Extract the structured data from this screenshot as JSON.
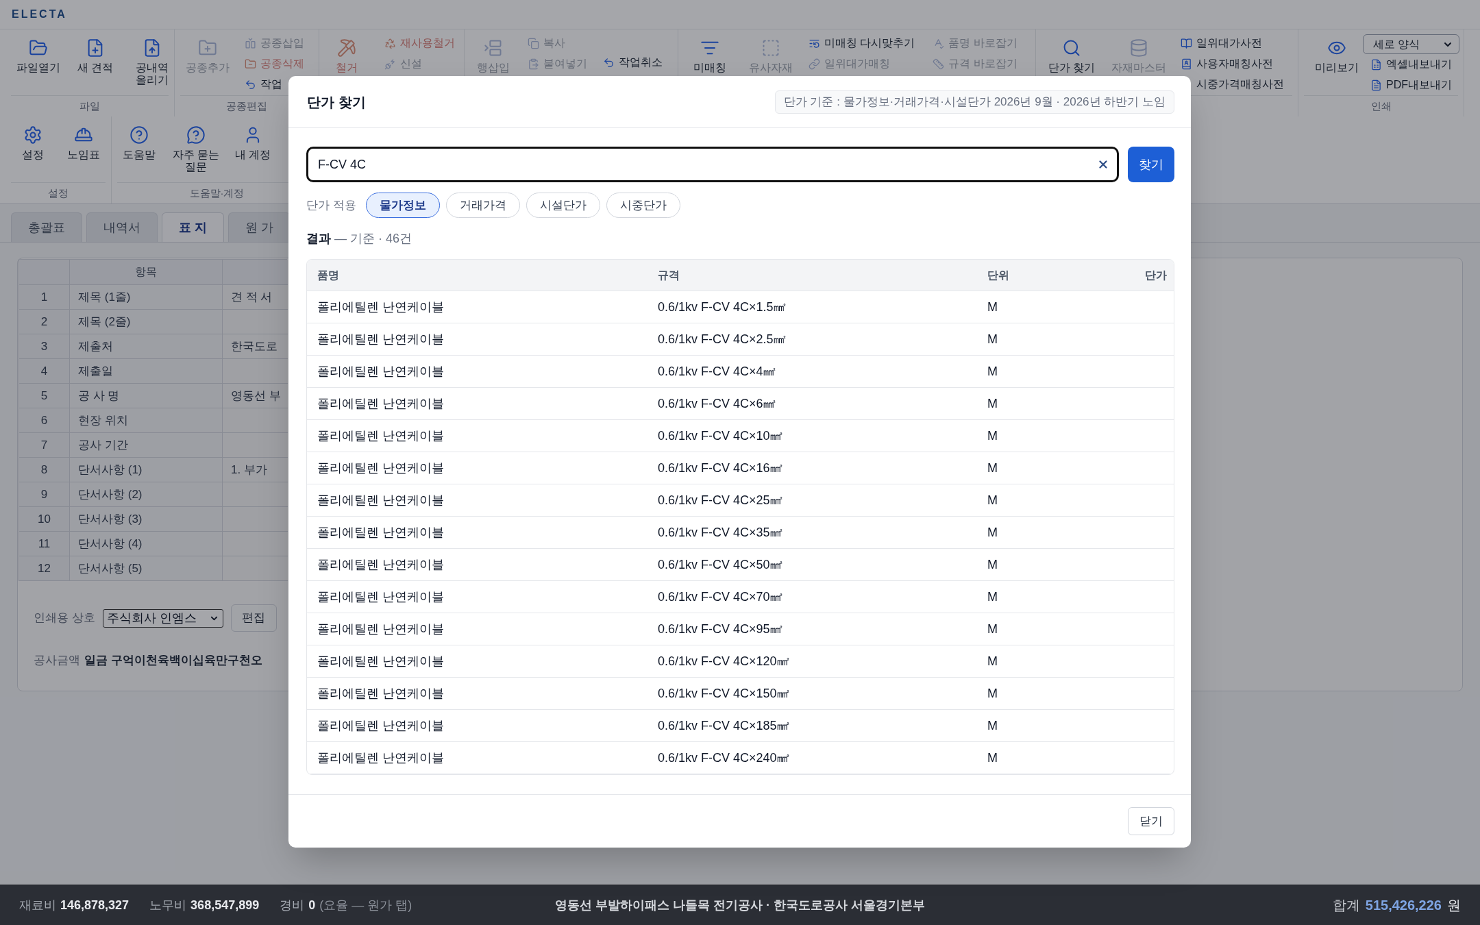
{
  "app": {
    "logo": "ELECTA"
  },
  "ribbon": {
    "rows": [
      [
        {
          "label": "파일",
          "blocks": [
            {
              "kind": "large",
              "label": "파일열기",
              "disabled": false,
              "danger": false
            },
            {
              "kind": "large",
              "label": "새 견적",
              "disabled": false,
              "danger": false
            },
            {
              "kind": "large",
              "label": "공내역 올리기",
              "disabled": false,
              "danger": false
            }
          ]
        },
        {
          "label": "공종편집",
          "blocks": [
            {
              "kind": "large",
              "label": "공종추가",
              "disabled": true,
              "danger": false
            },
            {
              "kind": "column",
              "items": [
                {
                  "kind": "button",
                  "label": "공종삽입",
                  "disabled": true,
                  "danger": false
                },
                {
                  "kind": "button",
                  "label": "공종삭제",
                  "disabled": true,
                  "danger": true
                },
                {
                  "kind": "button",
                  "label": "작업",
                  "disabled": false,
                  "danger": false
                }
              ]
            }
          ]
        },
        {
          "blocks": [
            {
              "kind": "large",
              "label": "철거",
              "disabled": true,
              "danger": true
            },
            {
              "kind": "column",
              "items": [
                {
                  "kind": "button",
                  "label": "재사용철거",
                  "disabled": true,
                  "danger": true
                },
                {
                  "kind": "button",
                  "label": "신설",
                  "disabled": true,
                  "danger": false
                }
              ]
            }
          ]
        },
        {
          "blocks": [
            {
              "kind": "large",
              "label": "행삽입",
              "disabled": true,
              "danger": false
            },
            {
              "kind": "column",
              "items": [
                {
                  "kind": "button",
                  "label": "복사",
                  "disabled": true,
                  "danger": false
                },
                {
                  "kind": "button",
                  "label": "붙여넣기",
                  "disabled": true,
                  "danger": false
                }
              ]
            },
            {
              "kind": "column",
              "items": [
                {
                  "kind": "button",
                  "label": "작업취소",
                  "disabled": false,
                  "danger": false
                }
              ]
            }
          ]
        },
        {
          "blocks": [
            {
              "kind": "large",
              "label": "미매칭",
              "disabled": false,
              "danger": false
            },
            {
              "kind": "large",
              "label": "유사자재",
              "disabled": true,
              "danger": false
            },
            {
              "kind": "column",
              "items": [
                {
                  "kind": "button",
                  "label": "미매칭 다시맞추기",
                  "disabled": false,
                  "danger": false
                },
                {
                  "kind": "button",
                  "label": "일위대가매칭",
                  "disabled": true,
                  "danger": false
                }
              ]
            },
            {
              "kind": "column",
              "items": [
                {
                  "kind": "button",
                  "label": "품명 바로잡기",
                  "disabled": true,
                  "danger": false
                },
                {
                  "kind": "button",
                  "label": "규격 바로잡기",
                  "disabled": true,
                  "danger": false
                }
              ]
            }
          ]
        },
        {
          "blocks": [
            {
              "kind": "large",
              "label": "단가 찾기",
              "disabled": false,
              "danger": false
            },
            {
              "kind": "large",
              "label": "자재마스터",
              "disabled": true,
              "danger": false
            },
            {
              "kind": "column",
              "items": [
                {
                  "kind": "button",
                  "label": "일위대가사전",
                  "disabled": false,
                  "danger": false
                },
                {
                  "kind": "button",
                  "label": "사용자매칭사전",
                  "disabled": false,
                  "danger": false
                },
                {
                  "kind": "button",
                  "label": "시중가격매칭사전",
                  "disabled": false,
                  "danger": false
                }
              ]
            }
          ]
        },
        {
          "label": "인쇄",
          "blocks": [
            {
              "kind": "large",
              "label": "미리보기",
              "disabled": false,
              "danger": false
            },
            {
              "kind": "column",
              "items": [
                {
                  "kind": "select",
                  "value": "세로 양식",
                  "disabled": false,
                  "danger": false
                },
                {
                  "kind": "button",
                  "label": "엑셀내보내기",
                  "disabled": false,
                  "danger": false
                },
                {
                  "kind": "button",
                  "label": "PDF내보내기",
                  "disabled": false,
                  "danger": false
                }
              ]
            }
          ]
        }
      ],
      [
        {
          "label": "설정",
          "blocks": [
            {
              "kind": "large",
              "label": "설정",
              "disabled": false,
              "danger": false
            },
            {
              "kind": "large",
              "label": "노임표",
              "disabled": false,
              "danger": false
            }
          ]
        },
        {
          "label": "도움말·계정",
          "blocks": [
            {
              "kind": "large",
              "label": "도움말",
              "disabled": false,
              "danger": false
            },
            {
              "kind": "large",
              "label": "자주 묻는 질문",
              "disabled": false,
              "danger": false
            },
            {
              "kind": "large",
              "label": "내 계정",
              "disabled": false,
              "danger": false
            }
          ]
        }
      ]
    ]
  },
  "sheet": {
    "tabs": [
      {
        "label": "총괄표",
        "selected": false
      },
      {
        "label": "내역서",
        "selected": false
      },
      {
        "label": "표 지",
        "selected": true
      },
      {
        "label": "원 가",
        "selected": false
      }
    ],
    "cover_table": {
      "header": "항목",
      "rows": [
        {
          "no": "1",
          "item": "제목 (1줄)",
          "value": "견 적 서"
        },
        {
          "no": "2",
          "item": "제목 (2줄)"
        },
        {
          "no": "3",
          "item": "제출처",
          "value": "한국도로"
        },
        {
          "no": "4",
          "item": "제출일"
        },
        {
          "no": "5",
          "item": "공 사 명",
          "value": "영동선 부"
        },
        {
          "no": "6",
          "item": "현장 위치"
        },
        {
          "no": "7",
          "item": "공사 기간"
        },
        {
          "no": "8",
          "item": "단서사항 (1)",
          "value": "1. 부가"
        },
        {
          "no": "9",
          "item": "단서사항 (2)"
        },
        {
          "no": "10",
          "item": "단서사항 (3)"
        },
        {
          "no": "11",
          "item": "단서사항 (4)"
        },
        {
          "no": "12",
          "item": "단서사항 (5)"
        }
      ]
    },
    "print_name": {
      "label": "인쇄용 상호",
      "value": "주식회사 인엠스",
      "edit_button": "편집"
    },
    "amount": {
      "label": "공사금액",
      "value": "일금 구억이천육백이십육만구천오"
    }
  },
  "dialog": {
    "title": "단가 찾기",
    "basis": "단가 기준 : 물가정보·거래가격·시설단가 2026년 9월 · 2026년 하반기 노임",
    "search": {
      "value": "F-CV 4C"
    },
    "search_button": "찾기",
    "price_filter": {
      "label": "단가 적용",
      "options": [
        {
          "label": "물가정보",
          "selected": true
        },
        {
          "label": "거래가격",
          "selected": false
        },
        {
          "label": "시설단가",
          "selected": false
        },
        {
          "label": "시중단가",
          "selected": false
        }
      ]
    },
    "result": "**결과** — 기준 · 46건",
    "table": {
      "columns": [
        "품명",
        "규격",
        "단위",
        "단가"
      ],
      "rows": [
        {
          "name": "폴리에틸렌 난연케이블",
          "spec": "0.6/1kv F-CV 4C×1.5㎟",
          "unit": "M"
        },
        {
          "name": "폴리에틸렌 난연케이블",
          "spec": "0.6/1kv F-CV 4C×2.5㎟",
          "unit": "M"
        },
        {
          "name": "폴리에틸렌 난연케이블",
          "spec": "0.6/1kv F-CV 4C×4㎟",
          "unit": "M"
        },
        {
          "name": "폴리에틸렌 난연케이블",
          "spec": "0.6/1kv F-CV 4C×6㎟",
          "unit": "M"
        },
        {
          "name": "폴리에틸렌 난연케이블",
          "spec": "0.6/1kv F-CV 4C×10㎟",
          "unit": "M"
        },
        {
          "name": "폴리에틸렌 난연케이블",
          "spec": "0.6/1kv F-CV 4C×16㎟",
          "unit": "M"
        },
        {
          "name": "폴리에틸렌 난연케이블",
          "spec": "0.6/1kv F-CV 4C×25㎟",
          "unit": "M"
        },
        {
          "name": "폴리에틸렌 난연케이블",
          "spec": "0.6/1kv F-CV 4C×35㎟",
          "unit": "M"
        },
        {
          "name": "폴리에틸렌 난연케이블",
          "spec": "0.6/1kv F-CV 4C×50㎟",
          "unit": "M"
        },
        {
          "name": "폴리에틸렌 난연케이블",
          "spec": "0.6/1kv F-CV 4C×70㎟",
          "unit": "M"
        },
        {
          "name": "폴리에틸렌 난연케이블",
          "spec": "0.6/1kv F-CV 4C×95㎟",
          "unit": "M"
        },
        {
          "name": "폴리에틸렌 난연케이블",
          "spec": "0.6/1kv F-CV 4C×120㎟",
          "unit": "M"
        },
        {
          "name": "폴리에틸렌 난연케이블",
          "spec": "0.6/1kv F-CV 4C×150㎟",
          "unit": "M"
        },
        {
          "name": "폴리에틸렌 난연케이블",
          "spec": "0.6/1kv F-CV 4C×185㎟",
          "unit": "M"
        },
        {
          "name": "폴리에틸렌 난연케이블",
          "spec": "0.6/1kv F-CV 4C×240㎟",
          "unit": "M"
        }
      ]
    },
    "close_button": "닫기"
  },
  "status_bar": {
    "costs": [
      {
        "label": "재료비",
        "value": "146,878,327"
      },
      {
        "label": "노무비",
        "value": "368,547,899"
      },
      {
        "label": "경비",
        "value": "0",
        "note": "(요율 — 원가 탭)"
      }
    ],
    "project": "영동선 부발하이패스 나들목 전기공사 · 한국도로공사 서울경기본부",
    "total": {
      "label": "합계",
      "value": "515,426,226",
      "unit": "원"
    }
  }
}
